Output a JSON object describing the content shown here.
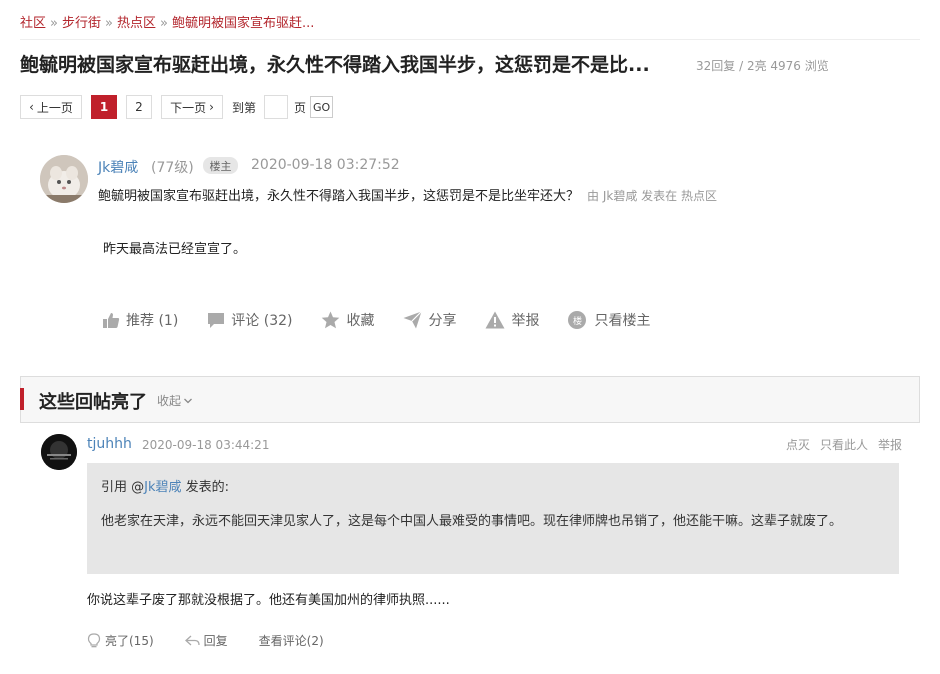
{
  "breadcrumb": {
    "items": [
      "社区",
      "步行街",
      "热点区",
      "鲍毓明被国家宣布驱赶..."
    ],
    "separator": "»"
  },
  "post": {
    "title": "鲍毓明被国家宣布驱赶出境，永久性不得踏入我国半步，这惩罚是不是比...",
    "stats": "32回复 / 2亮 4976 浏览",
    "author": "Jk碧咸",
    "level": "(77级)",
    "badge": "楼主",
    "time": "2020-09-18 03:27:52",
    "subtitle": "鲍毓明被国家宣布驱赶出境，永久性不得踏入我国半步，这惩罚是不是比坐牢还大？",
    "meta": "由  Jk碧咸 发表在  热点区",
    "body": "昨天最高法已经宣宣了。",
    "actions": {
      "recommend": "推荐 (1)",
      "comment": "评论 (32)",
      "favorite": "收藏",
      "share": "分享",
      "report": "举报",
      "only_op": "只看楼主",
      "only_op_icon_text": "楼"
    }
  },
  "pagination": {
    "prev": "上一页",
    "pages": [
      "1",
      "2"
    ],
    "current": "1",
    "next": "下一页",
    "goto_label": "到第",
    "page_label": "页",
    "go": "GO",
    "goto_value": ""
  },
  "highlights": {
    "title": "这些回帖亮了",
    "collapse": "收起",
    "reply": {
      "author": "tjuhhh",
      "time": "2020-09-18 03:44:21",
      "ops": [
        "点灭",
        "只看此人",
        "举报"
      ],
      "quote_prefix": "引用 @",
      "quote_author": "Jk碧咸",
      "quote_suffix": " 发表的:",
      "quote_body": "他老家在天津，永远不能回天津见家人了，这是每个中国人最难受的事情吧。现在律师牌也吊销了，他还能干嘛。这辈子就废了。",
      "body": "你说这辈子废了那就没根据了。他还有美国加州的律师执照......",
      "likes": "亮了(15)",
      "reply_label": "回复",
      "view_comments": "查看评论(2)"
    }
  },
  "colors": {
    "accent": "#c0202b",
    "link": "#4c83b8"
  }
}
